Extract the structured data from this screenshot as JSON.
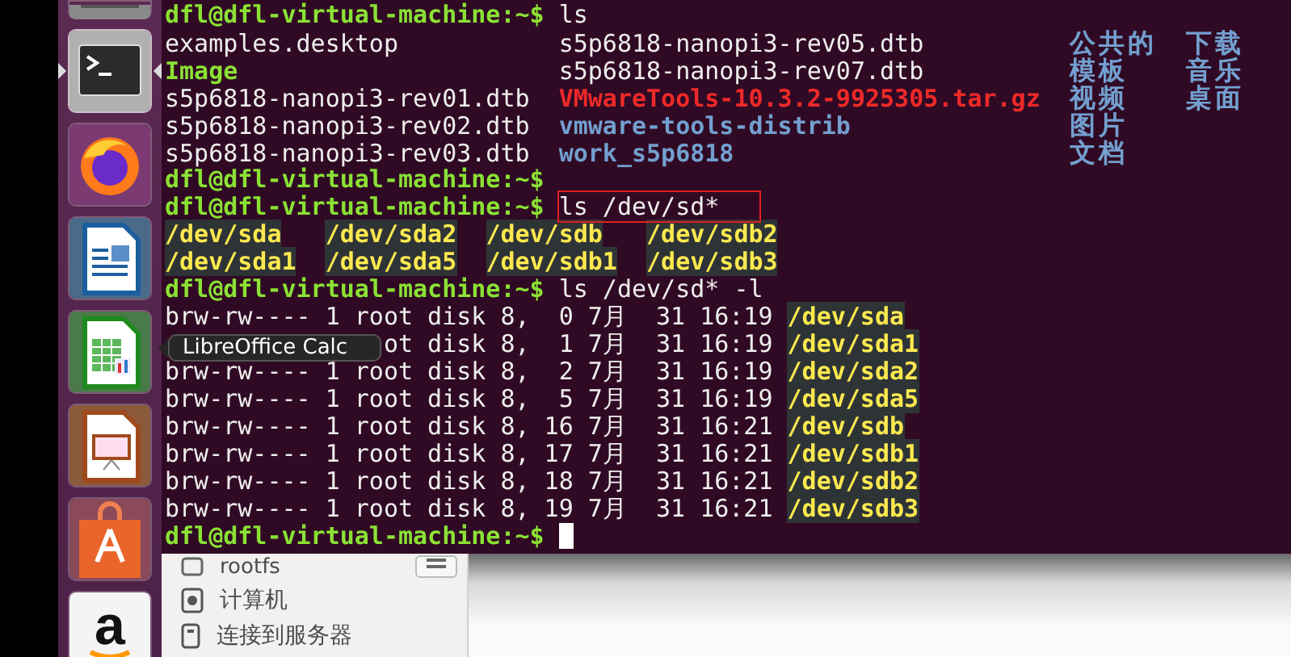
{
  "launcher": {
    "items": [
      {
        "kind": "partial",
        "selected": false
      },
      {
        "kind": "terminal",
        "selected": true
      },
      {
        "kind": "firefox",
        "selected": false
      },
      {
        "kind": "writer",
        "selected": false
      },
      {
        "kind": "calc",
        "selected": false,
        "tooltip": "LibreOffice Calc"
      },
      {
        "kind": "impress",
        "selected": false
      },
      {
        "kind": "store",
        "selected": false
      },
      {
        "kind": "amazon",
        "selected": false,
        "logo_text": "a"
      }
    ]
  },
  "terminal": {
    "cursor": true,
    "lines": [
      [
        {
          "kind": "prompt",
          "text": "dfl@dfl-virtual-machine:~$ "
        },
        {
          "kind": "command",
          "text": "ls",
          "boxed": false
        }
      ],
      [
        {
          "kind": "file",
          "text": "examples.desktop           "
        },
        {
          "kind": "file",
          "text": "s5p6818-nanopi3-rev05.dtb          "
        },
        {
          "kind": "dir",
          "text": "公共的  "
        },
        {
          "kind": "dir",
          "text": "下载"
        }
      ],
      [
        {
          "kind": "exec",
          "text": "Image                      "
        },
        {
          "kind": "file",
          "text": "s5p6818-nanopi3-rev07.dtb          "
        },
        {
          "kind": "dir",
          "text": "模板    "
        },
        {
          "kind": "dir",
          "text": "音乐"
        }
      ],
      [
        {
          "kind": "file",
          "text": "s5p6818-nanopi3-rev01.dtb  "
        },
        {
          "kind": "archive",
          "text": "VMwareTools-10.3.2-9925305.tar.gz  "
        },
        {
          "kind": "dir",
          "text": "视频    "
        },
        {
          "kind": "dir",
          "text": "桌面"
        }
      ],
      [
        {
          "kind": "file",
          "text": "s5p6818-nanopi3-rev02.dtb  "
        },
        {
          "kind": "dir",
          "text": "vmware-tools-distrib               "
        },
        {
          "kind": "dir",
          "text": "图片"
        }
      ],
      [
        {
          "kind": "file",
          "text": "s5p6818-nanopi3-rev03.dtb  "
        },
        {
          "kind": "dir",
          "text": "work_s5p6818                       "
        },
        {
          "kind": "dir",
          "text": "文档"
        }
      ],
      [
        {
          "kind": "prompt",
          "text": "dfl@dfl-virtual-machine:~$"
        }
      ],
      [
        {
          "kind": "prompt",
          "text": "dfl@dfl-virtual-machine:~$ "
        },
        {
          "kind": "command",
          "text": "ls /dev/sd*",
          "boxed": true
        }
      ],
      [
        {
          "kind": "device",
          "text": "/dev/sda   "
        },
        {
          "kind": "device",
          "text": "/dev/sda2  "
        },
        {
          "kind": "device",
          "text": "/dev/sdb   "
        },
        {
          "kind": "device",
          "text": "/dev/sdb2"
        }
      ],
      [
        {
          "kind": "device",
          "text": "/dev/sda1  "
        },
        {
          "kind": "device",
          "text": "/dev/sda5  "
        },
        {
          "kind": "device",
          "text": "/dev/sdb1  "
        },
        {
          "kind": "device",
          "text": "/dev/sdb3"
        }
      ],
      [
        {
          "kind": "prompt",
          "text": "dfl@dfl-virtual-machine:~$ "
        },
        {
          "kind": "command",
          "text": "ls /dev/sd* -l",
          "boxed": false
        }
      ],
      [
        {
          "kind": "file",
          "text": "brw-rw---- 1 root disk 8,  0 7月  31 16:19 "
        },
        {
          "kind": "device",
          "text": "/dev/sda"
        }
      ],
      [
        {
          "kind": "file",
          "text": "               ot disk 8,  1 7月  31 16:19 "
        },
        {
          "kind": "device",
          "text": "/dev/sda1"
        }
      ],
      [
        {
          "kind": "file",
          "text": "brw-rw---- 1 root disk 8,  2 7月  31 16:19 "
        },
        {
          "kind": "device",
          "text": "/dev/sda2"
        }
      ],
      [
        {
          "kind": "file",
          "text": "brw-rw---- 1 root disk 8,  5 7月  31 16:19 "
        },
        {
          "kind": "device",
          "text": "/dev/sda5"
        }
      ],
      [
        {
          "kind": "file",
          "text": "brw-rw---- 1 root disk 8, 16 7月  31 16:21 "
        },
        {
          "kind": "device",
          "text": "/dev/sdb"
        }
      ],
      [
        {
          "kind": "file",
          "text": "brw-rw---- 1 root disk 8, 17 7月  31 16:21 "
        },
        {
          "kind": "device",
          "text": "/dev/sdb1"
        }
      ],
      [
        {
          "kind": "file",
          "text": "brw-rw---- 1 root disk 8, 18 7月  31 16:21 "
        },
        {
          "kind": "device",
          "text": "/dev/sdb2"
        }
      ],
      [
        {
          "kind": "file",
          "text": "brw-rw---- 1 root disk 8, 19 7月  31 16:21 "
        },
        {
          "kind": "device",
          "text": "/dev/sdb3"
        }
      ],
      [
        {
          "kind": "prompt",
          "text": "dfl@dfl-virtual-machine:~$ "
        }
      ]
    ]
  },
  "files_sidebar": {
    "items": [
      {
        "kind": "drive",
        "label": "rootfs",
        "eject": true
      },
      {
        "kind": "computer",
        "label": "计算机",
        "eject": false
      },
      {
        "kind": "server",
        "label": "连接到服务器",
        "eject": false
      }
    ]
  }
}
